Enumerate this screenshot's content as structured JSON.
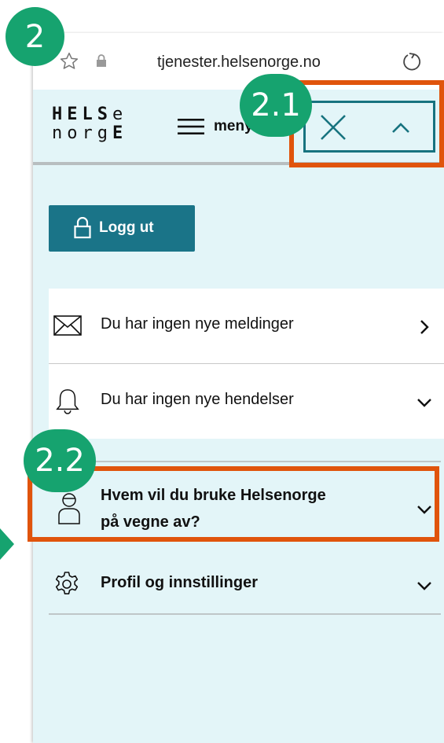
{
  "browser": {
    "url": "tjenester.helsenorge.no",
    "icons": [
      "star-icon",
      "lock-icon",
      "reload-icon"
    ]
  },
  "header": {
    "logo_line1_a": "HELS",
    "logo_line1_b": "e",
    "logo_line2_a": "norg",
    "logo_line2_b": "E",
    "menu_label": "meny",
    "icons": [
      "hamburger-icon",
      "close-icon",
      "chevron-up-icon"
    ]
  },
  "logout": {
    "label": "Logg ut",
    "icon": "lock-icon"
  },
  "menu": {
    "messages": {
      "label": "Du har ingen nye meldinger",
      "icon": "envelope-icon",
      "chevron": "chevron-right-icon"
    },
    "events": {
      "label": "Du har ingen nye hendelser",
      "icon": "bell-icon",
      "chevron": "chevron-down-icon"
    },
    "who": {
      "line1": "Hvem vil du bruke Helsenorge",
      "line2": "på vegne av?",
      "icon": "person-icon",
      "chevron": "chevron-down-icon"
    },
    "profile": {
      "label": "Profil og innstillinger",
      "icon": "gear-icon",
      "chevron": "chevron-down-icon"
    }
  },
  "annotations": {
    "step": "2",
    "step_close": "2.1",
    "step_who": "2.2",
    "badge_color": "#16a36f",
    "highlight_color": "#e0540c"
  },
  "colors": {
    "panel_bg": "#e3f5f8",
    "button_bg": "#1a7488",
    "accent": "#17737f"
  }
}
